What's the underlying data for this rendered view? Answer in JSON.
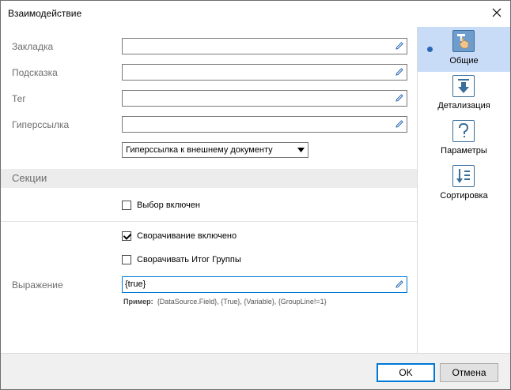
{
  "window": {
    "title": "Взаимодействие"
  },
  "form": {
    "fields": [
      {
        "label": "Закладка",
        "value": ""
      },
      {
        "label": "Подсказка",
        "value": ""
      },
      {
        "label": "Тег",
        "value": ""
      },
      {
        "label": "Гиперссылка",
        "value": ""
      }
    ],
    "hyperlink_type": "Гиперссылка к внешнему документу",
    "section_title": "Секции",
    "selection_enabled": {
      "label": "Выбор включен",
      "checked": false
    },
    "collapsing_enabled": {
      "label": "Сворачивание включено",
      "checked": true
    },
    "collapse_group_total": {
      "label": "Сворачивать Итог Группы",
      "checked": false
    },
    "expression_label": "Выражение",
    "expression_value": "{true}",
    "hint_prefix": "Пример:",
    "hint_text": "{DataSource.Field}, {True}, {Variable}, {GroupLine!=1}"
  },
  "sidebar": {
    "items": [
      {
        "label": "Общие",
        "icon": "hand-pointer-icon",
        "active": true
      },
      {
        "label": "Детализация",
        "icon": "arrow-down-icon",
        "active": false
      },
      {
        "label": "Параметры",
        "icon": "question-icon",
        "active": false
      },
      {
        "label": "Сортировка",
        "icon": "sort-icon",
        "active": false
      }
    ]
  },
  "footer": {
    "ok_label": "OK",
    "cancel_label": "Отмена"
  },
  "colors": {
    "accent": "#0078d7",
    "active_nav_bg": "#c9dcf7",
    "section_bg": "#ececec"
  }
}
